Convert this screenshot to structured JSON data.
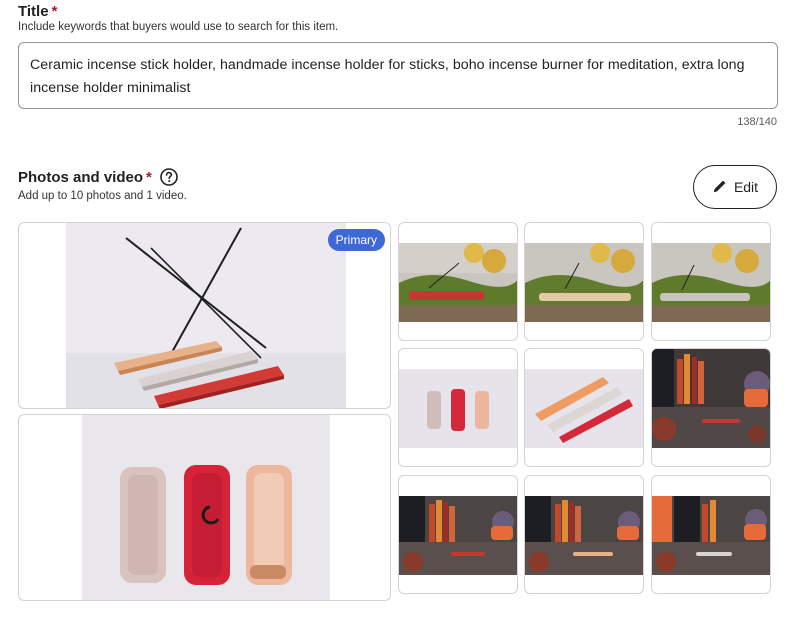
{
  "title_section": {
    "label": "Title",
    "required_mark": "*",
    "help_text": "Include keywords that buyers would use to search for this item.",
    "value": "Ceramic incense stick holder, handmade incense holder for sticks, boho incense burner for meditation, extra long incense holder minimalist",
    "counter": "138/140"
  },
  "photos_section": {
    "label": "Photos and video",
    "required_mark": "*",
    "help_icon": "question-circle-icon",
    "help_text": "Add up to 10 photos and 1 video.",
    "edit_label": "Edit",
    "edit_icon": "pencil-icon",
    "primary_badge": "Primary",
    "photo_count": 11
  },
  "colors": {
    "required": "#a61a2e",
    "badge": "#3e68d6",
    "border": "#959595"
  }
}
